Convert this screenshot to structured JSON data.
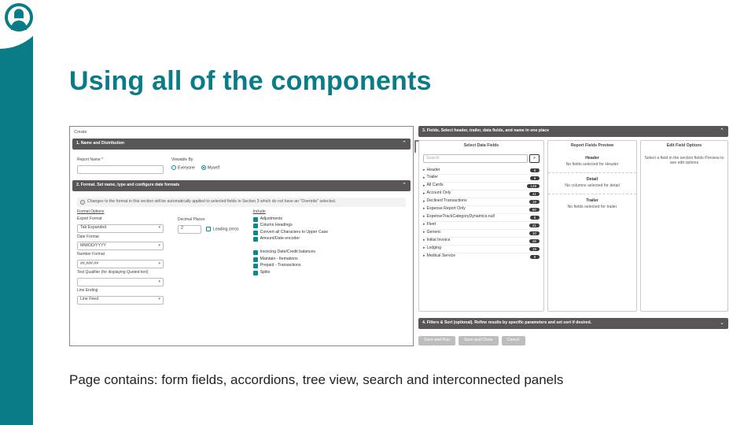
{
  "slide": {
    "title": "Using all of the components",
    "caption": "Page contains: form fields, accordions, tree view, search and interconnected panels"
  },
  "breadcrumb": "Create",
  "acc1": {
    "title": "1. Name and Distribution",
    "report_name_label": "Report Name *",
    "viewable_by_label": "Viewable By",
    "opt_everyone": "Everyone",
    "opt_myself": "Myself"
  },
  "acc2": {
    "title": "2. Format. Set name, type and configure date formats",
    "note": "Changes to the format in this section will be automatically applied to selected fields in Section 3 which do not have an \"Override\" selected.",
    "format_options": "Format Options",
    "export_format_label": "Export Format",
    "export_format_value": "Tab Expanded",
    "date_format_label": "Date Format",
    "date_format_value": "MM/DD/YYYY",
    "number_format_label": "Number Format",
    "number_format_value": "##,###.##",
    "text_qualifier_label": "Text Qualifier (for displaying Quoted text)",
    "line_ending_label": "Line Ending",
    "line_ending_value": "Line Feed",
    "decimal_places_label": "Decimal Places",
    "decimal_value": "2",
    "leading_zeros": "Leading zeros",
    "include_header": "Include",
    "adjustments": "Adjustments",
    "adj": [
      "Column Headings",
      "Convert all Characters to Upper Case",
      "Amount/Date encoder",
      "Invoicing Date/Credit balances",
      "Maintain - Itemations",
      "Prepaid - Transactions",
      "Splits"
    ]
  },
  "acc3": {
    "title": "3. Fields. Select header, trailer, data fields, and name in one place",
    "panel1": "Select Data Fields",
    "panel2": "Report Fields Preview",
    "panel3": "Edit Field Options",
    "search_placeholder": "Search",
    "p2_header": "Header",
    "p2_header_sub": "No fields selected for Header",
    "p2_detail": "Detail",
    "p2_detail_sub": "No columns selected for detail",
    "p2_trailer": "Trailer",
    "p2_trailer_sub": "No fields selected for trailer",
    "p3_msg": "Select a field in the section fields Preview to see edit options"
  },
  "tree": [
    {
      "label": "Header",
      "count": "8"
    },
    {
      "label": "Trailer",
      "count": "9"
    },
    {
      "label": "All Cards",
      "count": "149"
    },
    {
      "label": "Account Only",
      "count": "41"
    },
    {
      "label": "Declined Transactions",
      "count": "19"
    },
    {
      "label": "Expense Report Only",
      "count": "60"
    },
    {
      "label": "ExpenseTrackCategoryDynamics.null",
      "count": "8"
    },
    {
      "label": "Fleet",
      "count": "21"
    },
    {
      "label": "Generic",
      "count": "10"
    },
    {
      "label": "Initial Invoice",
      "count": "48"
    },
    {
      "label": "Lodging",
      "count": "19"
    },
    {
      "label": "Medical Service",
      "count": "8"
    }
  ],
  "acc4": {
    "title": "4. Filters & Sort (optional). Refine results by specific parameters and set sort if desired."
  },
  "buttons": {
    "save_run": "Save and Run",
    "save_close": "Save and Close",
    "cancel": "Cancel"
  }
}
